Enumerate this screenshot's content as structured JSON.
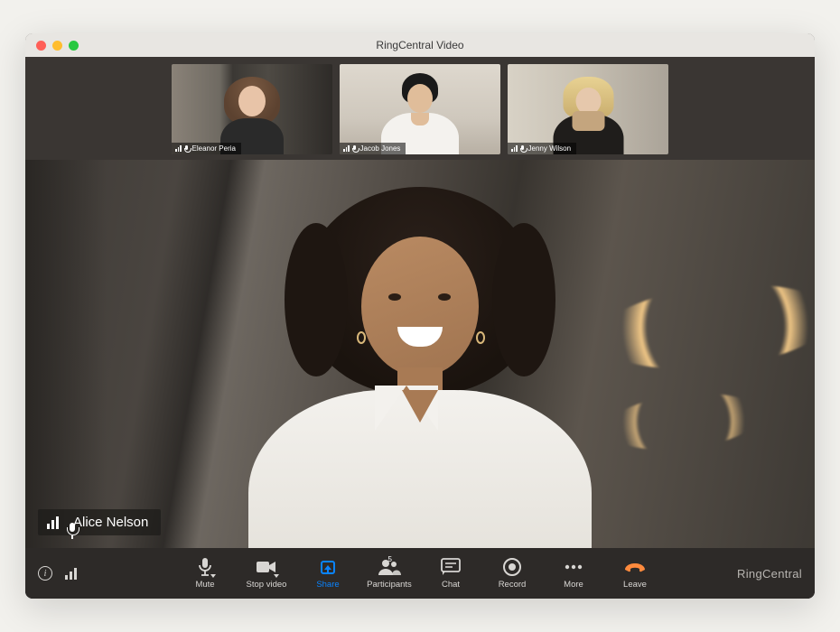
{
  "window": {
    "title": "RingCentral Video"
  },
  "thumbnails": [
    {
      "name": "Eleanor Peria"
    },
    {
      "name": "Jacob Jones"
    },
    {
      "name": "Jenny Wilson"
    }
  ],
  "main_speaker": {
    "name": "Alice Nelson"
  },
  "toolbar": {
    "mute": "Mute",
    "stop_video": "Stop video",
    "share": "Share",
    "participants": "Participants",
    "participants_count": "5",
    "chat": "Chat",
    "record": "Record",
    "more": "More",
    "leave": "Leave"
  },
  "brand": "RingCentral",
  "colors": {
    "share_accent": "#0a84ff",
    "leave_accent": "#ff8a3d"
  }
}
